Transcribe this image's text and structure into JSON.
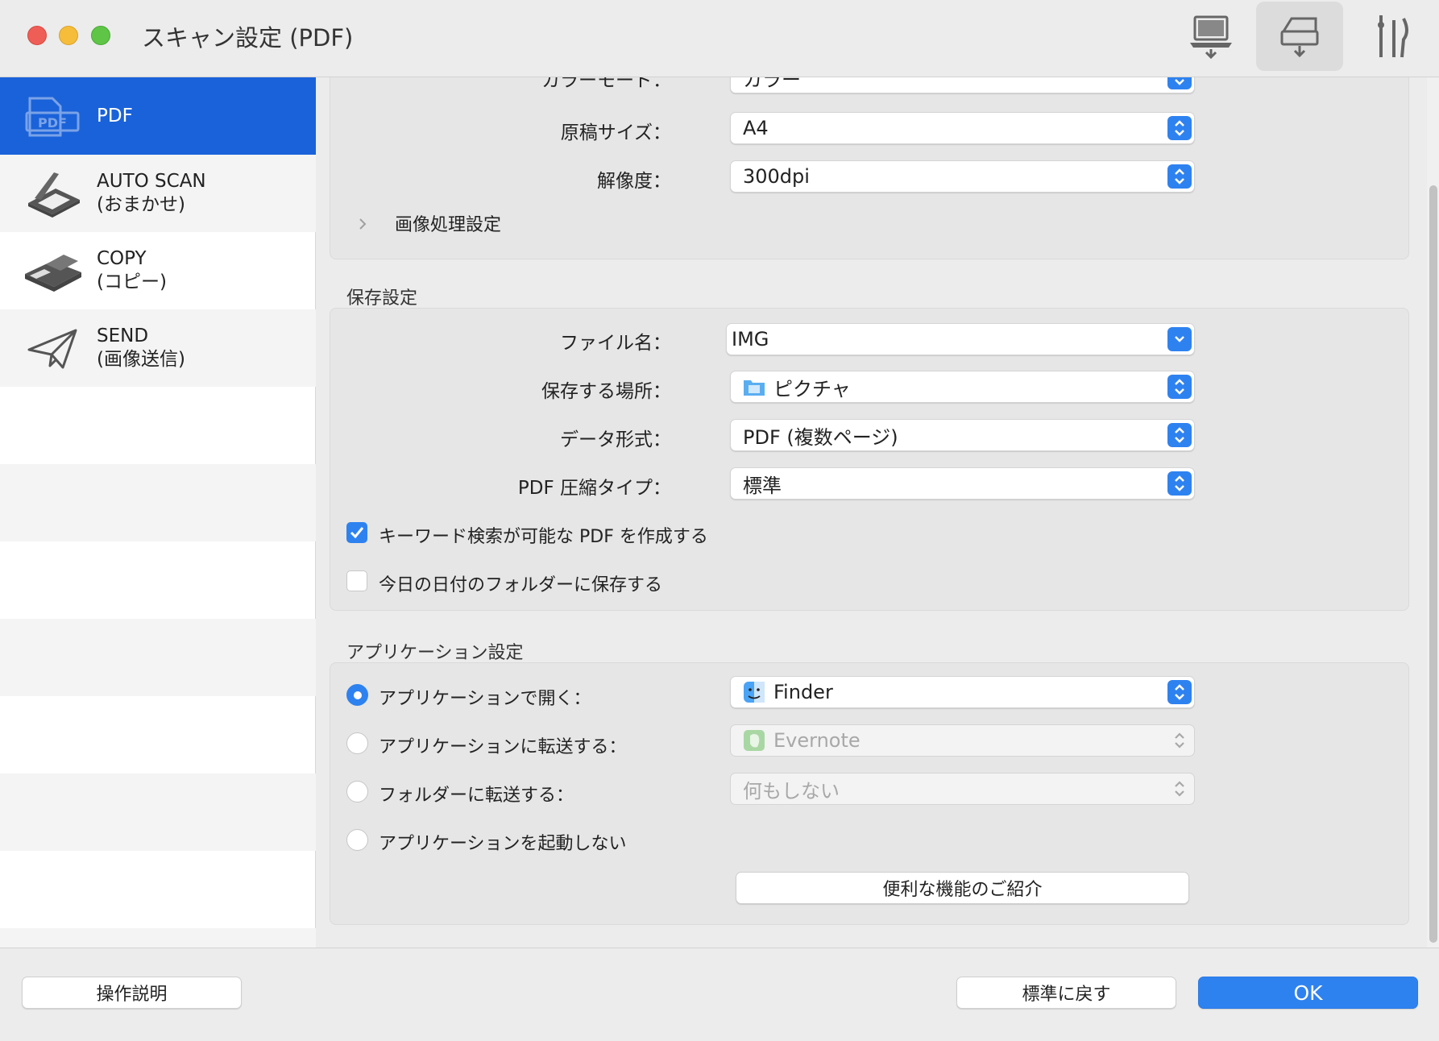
{
  "window": {
    "title": "スキャン設定 (PDF)"
  },
  "toolbar": {
    "items": [
      {
        "name": "computer-scan-icon"
      },
      {
        "name": "scan-from-panel-icon"
      },
      {
        "name": "general-settings-icon"
      }
    ]
  },
  "sidebar": {
    "items": [
      {
        "line1": "PDF",
        "line2": "",
        "selected": true,
        "icon": "pdf-icon"
      },
      {
        "line1": "AUTO SCAN",
        "line2": "(おまかせ)",
        "selected": false,
        "icon": "scanner-icon"
      },
      {
        "line1": "COPY",
        "line2": "(コピー)",
        "selected": false,
        "icon": "printer-icon"
      },
      {
        "line1": "SEND",
        "line2": "(画像送信)",
        "selected": false,
        "icon": "paper-plane-icon"
      }
    ]
  },
  "scan": {
    "color_mode_label": "カラーモード：",
    "color_mode_value": "カラー",
    "paper_size_label": "原稿サイズ：",
    "paper_size_value": "A4",
    "resolution_label": "解像度：",
    "resolution_value": "300dpi",
    "image_processing_label": "画像処理設定"
  },
  "save": {
    "section_title": "保存設定",
    "file_name_label": "ファイル名：",
    "file_name_value": "IMG",
    "location_label": "保存する場所：",
    "location_value": "ピクチャ",
    "format_label": "データ形式：",
    "format_value": "PDF (複数ページ)",
    "compression_label": "PDF 圧縮タイプ：",
    "compression_value": "標準",
    "keyword_search_label": "キーワード検索が可能な PDF を作成する",
    "keyword_search_checked": true,
    "date_folder_label": "今日の日付のフォルダーに保存する",
    "date_folder_checked": false
  },
  "app": {
    "section_title": "アプリケーション設定",
    "open_with_label": "アプリケーションで開く：",
    "open_with_value": "Finder",
    "send_to_app_label": "アプリケーションに転送する：",
    "send_to_app_value": "Evernote",
    "send_to_folder_label": "フォルダーに転送する：",
    "send_to_folder_value": "何もしない",
    "no_launch_label": "アプリケーションを起動しない",
    "features_button": "便利な機能のご紹介"
  },
  "footer": {
    "instructions_button": "操作説明",
    "defaults_button": "標準に戻す",
    "ok_button": "OK"
  },
  "colors": {
    "accent": "#2e82f0",
    "sidebar_selected": "#1a62d9"
  }
}
